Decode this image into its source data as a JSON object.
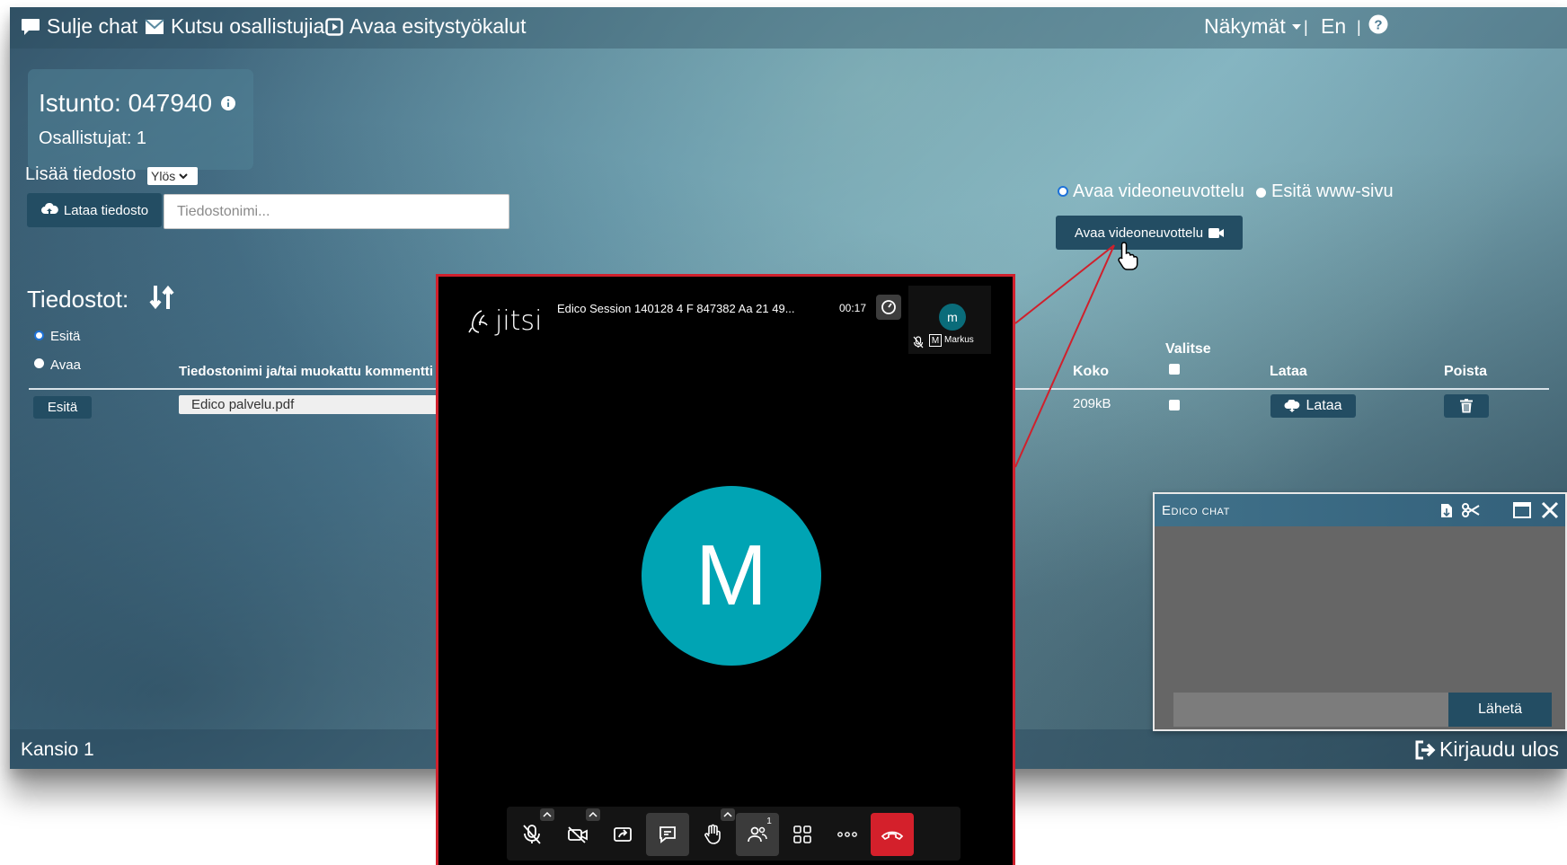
{
  "topbar": {
    "close_chat": "Sulje chat",
    "invite": "Kutsu osallistujia",
    "present_tools": "Avaa esitystyökalut",
    "views": "Näkymät",
    "lang": "En",
    "sep": "|"
  },
  "session": {
    "title": "Istunto: 047940",
    "participants": "Osallistujat: 1"
  },
  "upload": {
    "label": "Lisää tiedosto",
    "direction": "Ylös",
    "button": "Lataa tiedosto",
    "placeholder": "Tiedostonimi..."
  },
  "video": {
    "option_open": "Avaa videoneuvottelu",
    "option_web": "Esitä www-sivu",
    "button": "Avaa videoneuvottelu"
  },
  "files": {
    "heading": "Tiedostot:",
    "radio_present": "Esitä",
    "radio_open": "Avaa",
    "columns": {
      "name": "Tiedostonimi ja/tai muokattu kommentti",
      "size": "Koko",
      "select": "Valitse",
      "download": "Lataa",
      "delete": "Poista"
    },
    "rows": [
      {
        "action": "Esitä",
        "name": "Edico palvelu.pdf",
        "size": "209kB",
        "download": "Lataa"
      }
    ]
  },
  "footer": {
    "folder": "Kansio 1",
    "logout": "Kirjaudu ulos"
  },
  "jitsi": {
    "logo": "jitsi",
    "session_title": "Edico Session 140128 4 F 847382 Aa 21 49...",
    "timer": "00:17",
    "thumb_initial": "m",
    "thumb_badge": "M",
    "thumb_name": "Markus",
    "avatar_initial": "M",
    "participants_count": "1"
  },
  "chat": {
    "title": "Edico chat",
    "send": "Lähetä"
  },
  "colors": {
    "accent_dark": "#234d63",
    "jitsi_avatar": "#00a4b4",
    "hangup": "#d4202b",
    "highlight": "#d0202c"
  }
}
